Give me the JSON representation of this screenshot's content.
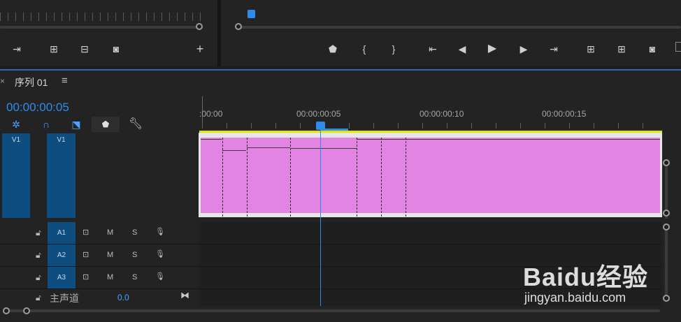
{
  "source_monitor": {
    "buttons": [
      "insert",
      "overwrite",
      "export-frame",
      "add"
    ]
  },
  "program_monitor": {
    "buttons": [
      "add-marker",
      "mark-in",
      "mark-out",
      "go-to-in",
      "step-back",
      "play",
      "step-forward",
      "go-to-out",
      "lift",
      "extract",
      "export-frame"
    ]
  },
  "sequence": {
    "close_glyph": "×",
    "tab_title": "序列 01",
    "menu_glyph": "≡",
    "timecode": "00:00:00:05",
    "ruler_labels": [
      ":00:00",
      "00:00:00:05",
      "00:00:00:10",
      "00:00:00:15"
    ]
  },
  "tracks": {
    "video": [
      {
        "source": "V1",
        "target": "V1"
      }
    ],
    "audio": [
      {
        "name": "A1",
        "mute": "M",
        "solo": "S"
      },
      {
        "name": "A2",
        "mute": "M",
        "solo": "S"
      },
      {
        "name": "A3",
        "mute": "M",
        "solo": "S"
      }
    ],
    "master": {
      "label": "主声道",
      "value": "0.0"
    }
  },
  "watermark": {
    "brand": "Baidu经验",
    "url": "jingyan.baidu.com"
  },
  "colors": {
    "accent": "#2d8ceb",
    "clip": "#e284e1",
    "track_blue": "#0e4d80",
    "work_area": "#e6e600"
  },
  "playhead_position_seconds_frames": "00:00:00:05"
}
